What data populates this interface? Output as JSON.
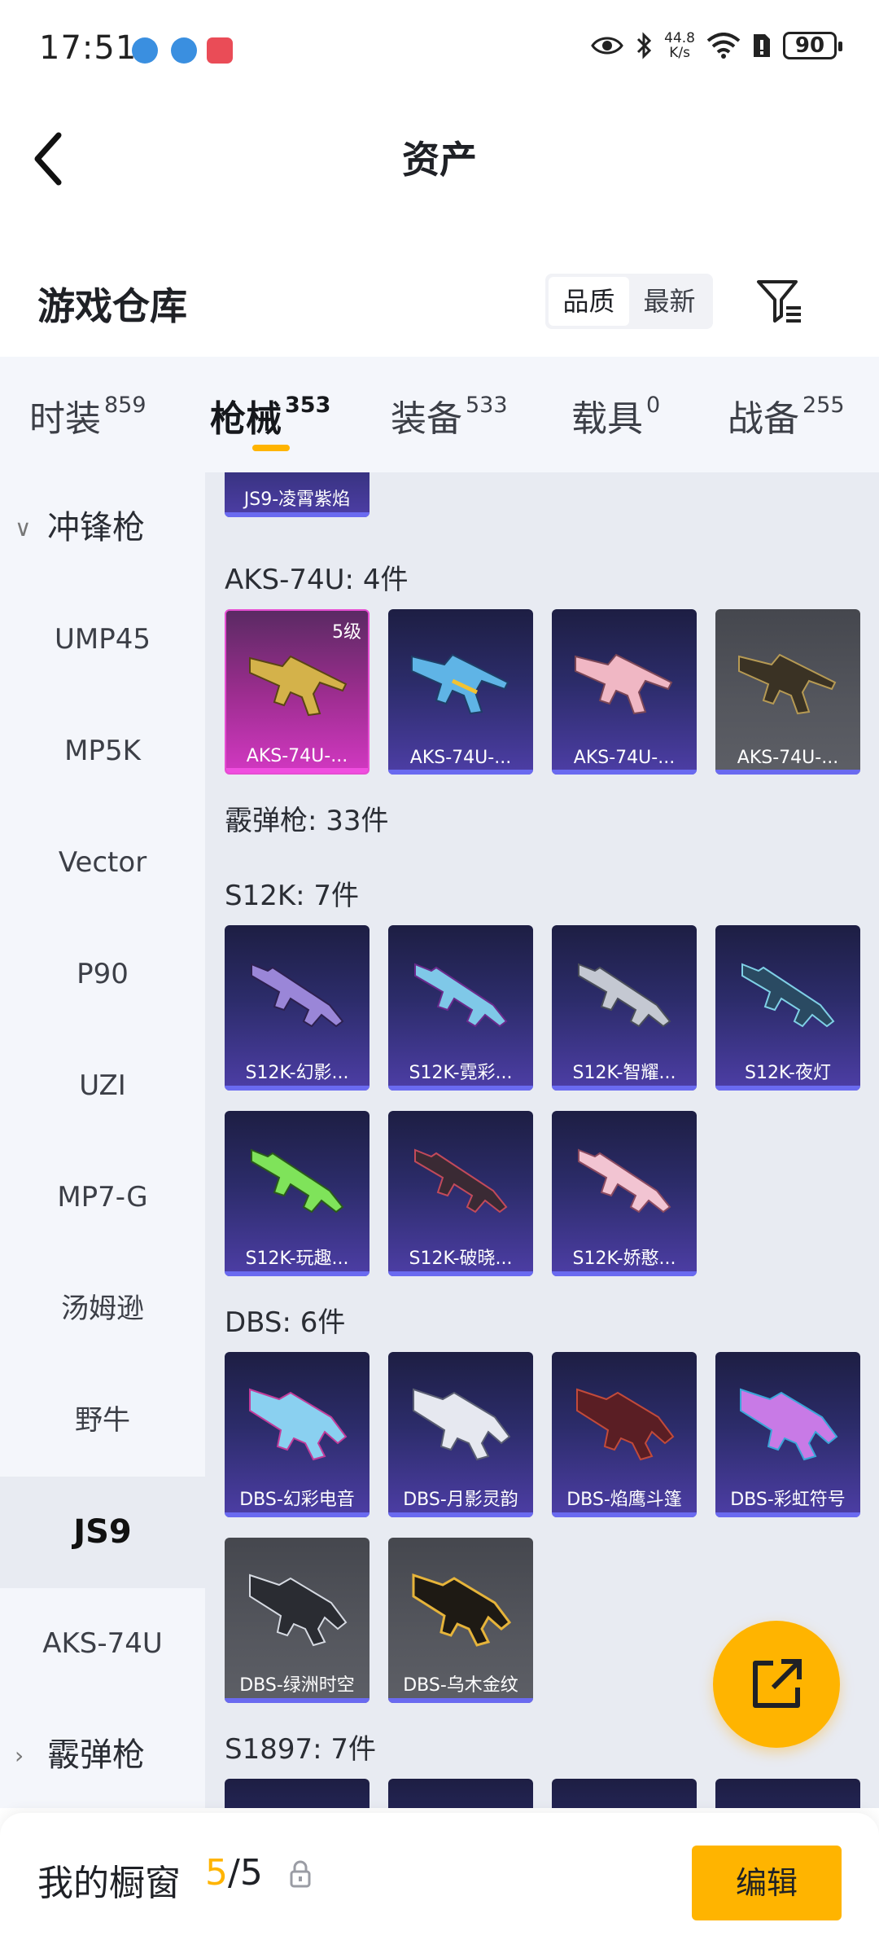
{
  "status_bar": {
    "time": "17:51",
    "speed_top": "44.8",
    "speed_bottom": "K/s",
    "battery": "90"
  },
  "header": {
    "title": "资产"
  },
  "warehouse": {
    "title": "游戏仓库",
    "sort_options": [
      "品质",
      "最新"
    ],
    "selected_sort": "品质"
  },
  "tabs": [
    {
      "label": "时装",
      "count": "859"
    },
    {
      "label": "枪械",
      "count": "353"
    },
    {
      "label": "装备",
      "count": "533"
    },
    {
      "label": "载具",
      "count": "0"
    },
    {
      "label": "战备",
      "count": "255"
    }
  ],
  "active_tab": "枪械",
  "sidebar": {
    "group_smg": "冲锋枪",
    "items": [
      "UMP45",
      "MP5K",
      "Vector",
      "P90",
      "UZI",
      "MP7-G",
      "汤姆逊",
      "野牛",
      "JS9",
      "AKS-74U"
    ],
    "active_item": "JS9",
    "group_shotgun": "霰弹枪"
  },
  "content": {
    "partial_card_label": "JS9-凌霄紫焰",
    "sections": [
      {
        "title": "AKS-74U: 4件",
        "cards": [
          {
            "label": "AKS-74U-...",
            "level": "5级",
            "quality": "gold"
          },
          {
            "label": "AKS-74U-...",
            "quality": "purple"
          },
          {
            "label": "AKS-74U-...",
            "quality": "purple"
          },
          {
            "label": "AKS-74U-...",
            "quality": "grey"
          }
        ]
      },
      {
        "title": "霰弹枪: 33件",
        "cards": []
      },
      {
        "title": "S12K: 7件",
        "cards": [
          {
            "label": "S12K-幻影...",
            "quality": "purple"
          },
          {
            "label": "S12K-霓彩...",
            "quality": "purple"
          },
          {
            "label": "S12K-智耀...",
            "quality": "purple"
          },
          {
            "label": "S12K-夜灯",
            "quality": "purple"
          },
          {
            "label": "S12K-玩趣...",
            "quality": "purple"
          },
          {
            "label": "S12K-破晓...",
            "quality": "purple"
          },
          {
            "label": "S12K-娇憨...",
            "quality": "purple"
          }
        ]
      },
      {
        "title": "DBS: 6件",
        "cards": [
          {
            "label": "DBS-幻彩电音",
            "quality": "purple"
          },
          {
            "label": "DBS-月影灵韵",
            "quality": "purple"
          },
          {
            "label": "DBS-焰鹰斗篷",
            "quality": "purple"
          },
          {
            "label": "DBS-彩虹符号",
            "quality": "purple"
          },
          {
            "label": "DBS-绿洲时空",
            "quality": "grey"
          },
          {
            "label": "DBS-乌木金纹",
            "quality": "grey"
          }
        ]
      },
      {
        "title": "S1897: 7件",
        "cards": []
      }
    ]
  },
  "bottom_bar": {
    "label": "我的橱窗",
    "current": "5",
    "separator_total": "/5",
    "edit_label": "编辑"
  },
  "colors": {
    "accent": "#ffb400",
    "purple_bar": "#6a6af0",
    "gold_card": "#d238c2"
  }
}
